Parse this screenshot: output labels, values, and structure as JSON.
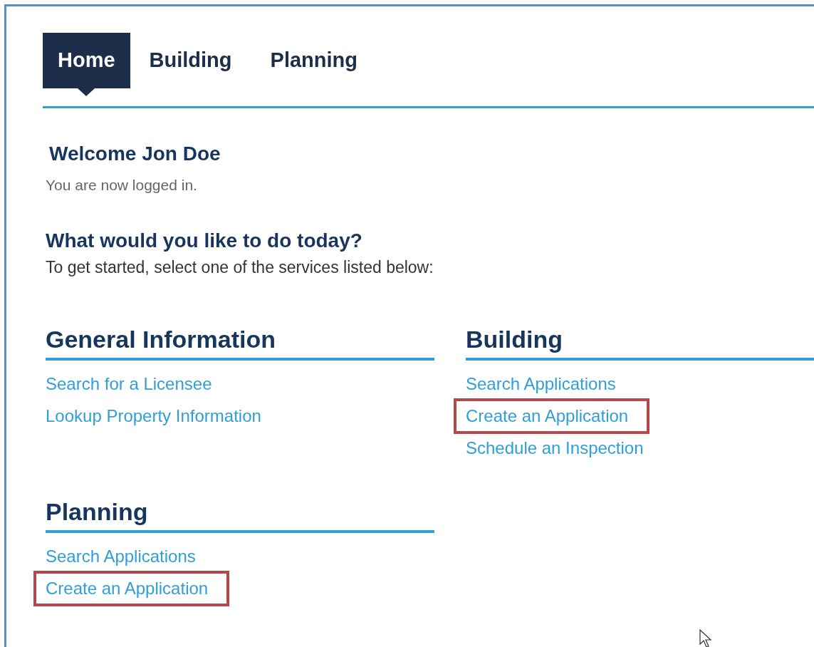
{
  "tabs": [
    {
      "label": "Home",
      "selected": true
    },
    {
      "label": "Building",
      "selected": false
    },
    {
      "label": "Planning",
      "selected": false
    }
  ],
  "welcome": {
    "title": "Welcome Jon Doe",
    "message": "You are now logged in."
  },
  "prompt": {
    "title": "What would you like to do today?",
    "subtitle": "To get started, select one of the services listed below:"
  },
  "sections": [
    {
      "title": "General Information",
      "links": [
        {
          "label": "Search for a Licensee",
          "highlighted": false
        },
        {
          "label": "Lookup Property Information",
          "highlighted": false
        }
      ]
    },
    {
      "title": "Building",
      "links": [
        {
          "label": "Search Applications",
          "highlighted": false
        },
        {
          "label": "Create an Application",
          "highlighted": true
        },
        {
          "label": "Schedule an Inspection",
          "highlighted": false
        }
      ]
    },
    {
      "title": "Planning",
      "links": [
        {
          "label": "Search Applications",
          "highlighted": false
        },
        {
          "label": "Create an Application",
          "highlighted": true
        }
      ]
    }
  ]
}
